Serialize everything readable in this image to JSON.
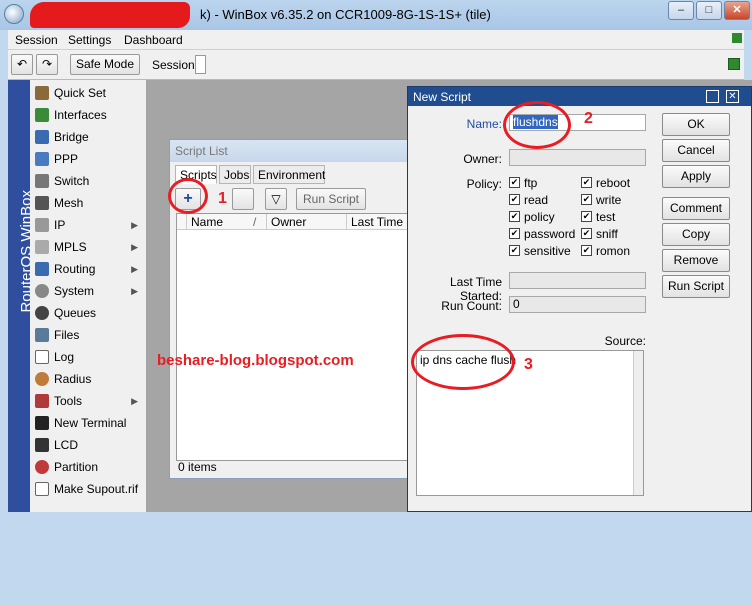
{
  "window": {
    "title": "k) - WinBox v6.35.2 on CCR1009-8G-1S-1S+ (tile)",
    "minimize": "–",
    "maximize": "□",
    "close": "✕"
  },
  "menu": {
    "items": [
      "Session",
      "Settings",
      "Dashboard"
    ]
  },
  "toolbar": {
    "safe_mode": "Safe Mode",
    "session_label": "Session:"
  },
  "sidebar": {
    "brand": "RouterOS WinBox",
    "items": [
      {
        "label": "Quick Set",
        "arrow": ""
      },
      {
        "label": "Interfaces",
        "arrow": ""
      },
      {
        "label": "Bridge",
        "arrow": ""
      },
      {
        "label": "PPP",
        "arrow": ""
      },
      {
        "label": "Switch",
        "arrow": ""
      },
      {
        "label": "Mesh",
        "arrow": ""
      },
      {
        "label": "IP",
        "arrow": "▶"
      },
      {
        "label": "MPLS",
        "arrow": "▶"
      },
      {
        "label": "Routing",
        "arrow": "▶"
      },
      {
        "label": "System",
        "arrow": "▶"
      },
      {
        "label": "Queues",
        "arrow": ""
      },
      {
        "label": "Files",
        "arrow": ""
      },
      {
        "label": "Log",
        "arrow": ""
      },
      {
        "label": "Radius",
        "arrow": ""
      },
      {
        "label": "Tools",
        "arrow": "▶"
      },
      {
        "label": "New Terminal",
        "arrow": ""
      },
      {
        "label": "LCD",
        "arrow": ""
      },
      {
        "label": "Partition",
        "arrow": ""
      },
      {
        "label": "Make Supout.rif",
        "arrow": ""
      }
    ]
  },
  "script_list": {
    "title": "Script List",
    "tabs": [
      "Scripts",
      "Jobs",
      "Environment"
    ],
    "run_script": "Run Script",
    "columns": [
      "Name",
      "/",
      "Owner",
      "Last Time Sta"
    ],
    "status": "0 items"
  },
  "watermark": "beshare-blog.blogspot.com",
  "annotations": [
    "1",
    "2",
    "3"
  ],
  "new_script": {
    "title": "New Script",
    "name_label": "Name:",
    "name_value": "flushdns",
    "owner_label": "Owner:",
    "policy_label": "Policy:",
    "policies": [
      "ftp",
      "reboot",
      "read",
      "write",
      "policy",
      "test",
      "password",
      "sniff",
      "sensitive",
      "romon"
    ],
    "last_time_label": "Last Time Started:",
    "run_count_label": "Run Count:",
    "run_count_value": "0",
    "source_label": "Source:",
    "source_value": "ip dns cache flush",
    "buttons": [
      "OK",
      "Cancel",
      "Apply",
      "Comment",
      "Copy",
      "Remove",
      "Run Script"
    ]
  }
}
